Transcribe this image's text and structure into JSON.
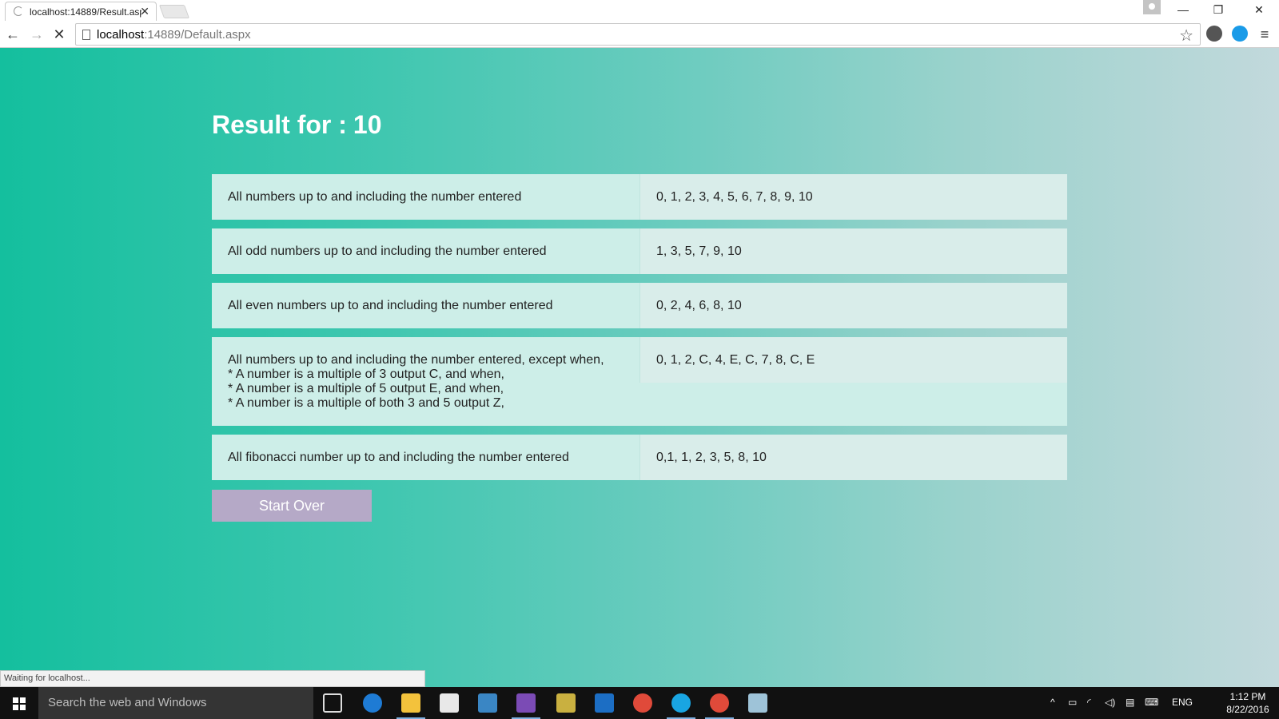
{
  "browser": {
    "tab_title": "localhost:14889/Result.asp",
    "url_host": "localhost",
    "url_path": ":14889/Default.aspx",
    "status_text": "Waiting for localhost..."
  },
  "page": {
    "title": "Result for :",
    "number": "10",
    "rows": [
      {
        "label_lines": [
          "All numbers up to and including the number entered"
        ],
        "value": "0, 1, 2, 3, 4, 5, 6, 7, 8, 9, 10"
      },
      {
        "label_lines": [
          "All odd numbers up to and including the number entered"
        ],
        "value": "1, 3, 5, 7, 9, 10"
      },
      {
        "label_lines": [
          "All even numbers up to and including the number entered"
        ],
        "value": "0, 2, 4, 6, 8, 10"
      },
      {
        "label_lines": [
          "All numbers up to and including the number entered, except  when,",
          "* A number is a multiple of 3 output C, and when,",
          "* A number is a multiple of 5 output E, and when,",
          "* A number is a multiple of both 3 and 5 output Z,"
        ],
        "value": "0, 1, 2, C, 4, E, C, 7, 8, C, E"
      },
      {
        "label_lines": [
          "All fibonacci number up to and including the number entered"
        ],
        "value": "0,1, 1, 2, 3, 5, 8, 10"
      }
    ],
    "start_over_label": "Start Over"
  },
  "taskbar": {
    "search_placeholder": "Search the web and Windows",
    "language": "ENG",
    "time": "1:12 PM",
    "date": "8/22/2016",
    "apps": [
      "task-view-icon",
      "edge-icon",
      "file-explorer-icon",
      "store-icon",
      "xamarin-icon",
      "visual-studio-icon",
      "tools-icon",
      "outlook-icon",
      "chrome-icon",
      "skype-icon",
      "chrome-icon",
      "notepad-icon"
    ]
  },
  "colors": {
    "gradient_start": "#14bf9e",
    "gradient_end": "#c2d9dc",
    "row_bg": "#cdeee8",
    "button_bg": "#b5a9c7"
  }
}
